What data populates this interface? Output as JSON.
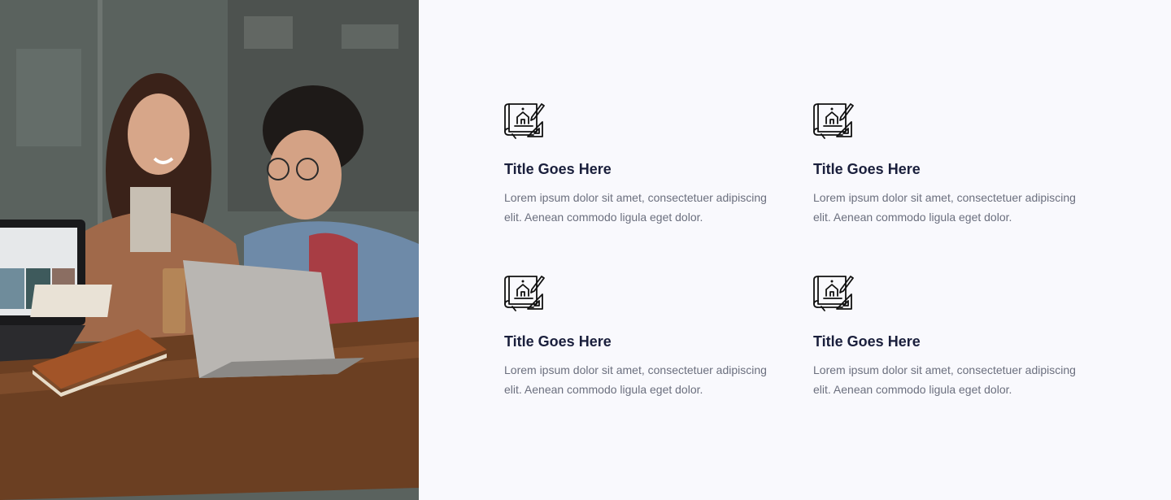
{
  "hero_image": {
    "description": "Two people laughing at a wooden table with laptops",
    "icon": "photo"
  },
  "features": [
    {
      "icon": "blueprint-icon",
      "title": "Title Goes Here",
      "text": "Lorem ipsum dolor sit amet, consectetuer adipiscing elit. Aenean commodo ligula eget dolor."
    },
    {
      "icon": "blueprint-icon",
      "title": "Title Goes Here",
      "text": "Lorem ipsum dolor sit amet, consectetuer adipiscing elit. Aenean commodo ligula eget dolor."
    },
    {
      "icon": "blueprint-icon",
      "title": "Title Goes Here",
      "text": "Lorem ipsum dolor sit amet, consectetuer adipiscing elit. Aenean commodo ligula eget dolor."
    },
    {
      "icon": "blueprint-icon",
      "title": "Title Goes Here",
      "text": "Lorem ipsum dolor sit amet, consectetuer adipiscing elit. Aenean commodo ligula eget dolor."
    }
  ],
  "colors": {
    "background": "#f9f9fd",
    "title": "#1a1f3c",
    "body_text": "#6b6f7e",
    "icon_stroke": "#111111"
  }
}
